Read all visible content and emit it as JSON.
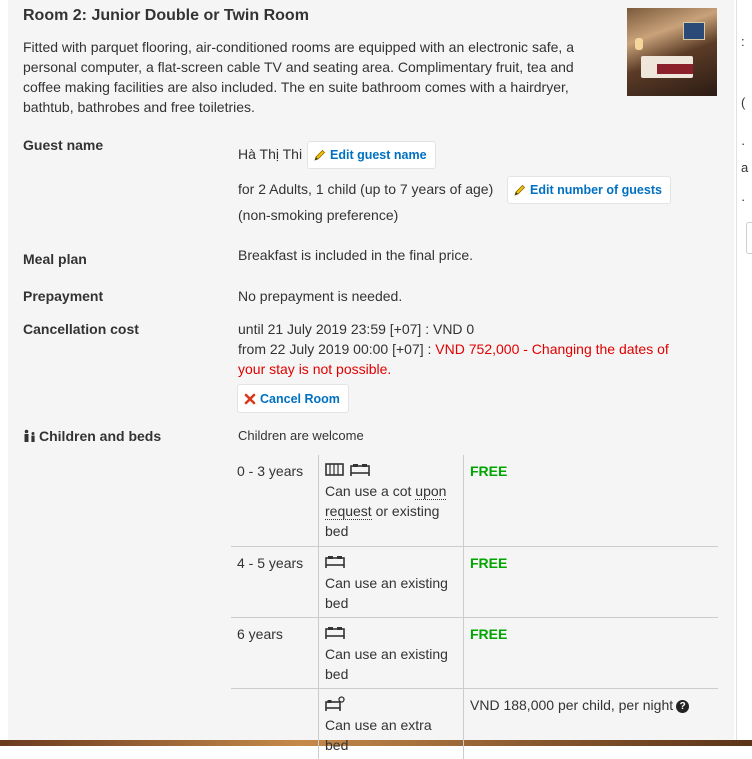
{
  "room": {
    "title": "Room 2: Junior Double or Twin Room",
    "description": "Fitted with parquet flooring, air-conditioned rooms are equipped with an electronic safe, a personal computer, a flat-screen cable TV and seating area. Complimentary fruit, tea and coffee making facilities are also included. The en suite bathroom comes with a hairdryer, bathtub, bathrobes and free toiletries."
  },
  "guest": {
    "label": "Guest name",
    "name": "Hà Thị Thi",
    "edit_name_label": "Edit guest name",
    "occupancy": "for 2 Adults, 1 child (up to 7 years of age)",
    "edit_guests_label": "Edit number of guests",
    "preference": "(non-smoking preference)"
  },
  "meal": {
    "label": "Meal plan",
    "value": "Breakfast is included in the final price."
  },
  "prepayment": {
    "label": "Prepayment",
    "value": "No prepayment is needed."
  },
  "cancellation": {
    "label": "Cancellation cost",
    "line1": "until 21 July 2019 23:59 [+07] : VND 0",
    "line2_prefix": "from 22 July 2019 00:00 [+07] : ",
    "line2_red_a": "VND 752,000 - Changing the dates of",
    "line2_red_b": "your stay is not possible.",
    "cancel_label": "Cancel Room"
  },
  "children": {
    "label": "Children and beds",
    "welcome": "Children are welcome",
    "rows": [
      {
        "age": "0 - 3 years",
        "bed_a": "Can use a cot ",
        "bed_dotted_a": "upon",
        "bed_dotted_b": "request",
        "bed_b": " or existing",
        "bed_c": "bed",
        "price": "FREE"
      },
      {
        "age": "4 - 5 years",
        "bed_a": "Can use an existing",
        "bed_c": "bed",
        "price": "FREE"
      },
      {
        "age": "6 years",
        "bed_a": "Can use an existing",
        "bed_c": "bed",
        "price": "FREE"
      },
      {
        "age": "",
        "bed_a": "Can use an extra bed",
        "price": "VND 188,000 per child, per night"
      }
    ]
  },
  "colors": {
    "link": "#0071c2",
    "free": "#00a500",
    "warning": "#e10000"
  },
  "icons": [
    "pencil-icon",
    "cross-icon",
    "family-icon",
    "cot-icon",
    "bed-icon",
    "extra-bed-icon",
    "question-icon"
  ]
}
